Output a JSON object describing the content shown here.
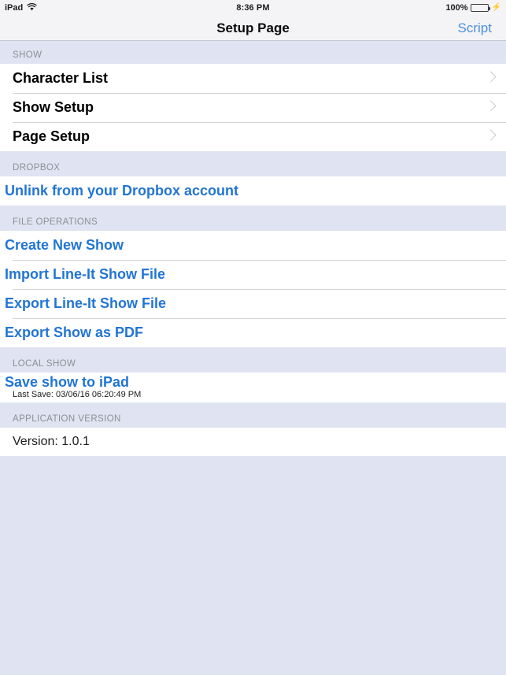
{
  "status_bar": {
    "device": "iPad",
    "wifi_icon": "wifi-icon",
    "time": "8:36 PM",
    "battery_percent": "100%",
    "battery_icon": "battery-full-icon",
    "charging_icon": "lightning-bolt-icon"
  },
  "nav": {
    "title": "Setup Page",
    "right_button": "Script"
  },
  "sections": [
    {
      "header": "SHOW",
      "rows": [
        {
          "label": "Character List",
          "style": "dark",
          "accessory": "chevron-right-icon"
        },
        {
          "label": "Show Setup",
          "style": "dark",
          "accessory": "chevron-right-icon"
        },
        {
          "label": "Page Setup",
          "style": "dark",
          "accessory": "chevron-right-icon"
        }
      ]
    },
    {
      "header": "DROPBOX",
      "rows": [
        {
          "label": "Unlink from your Dropbox account",
          "style": "link"
        }
      ]
    },
    {
      "header": "FILE OPERATIONS",
      "rows": [
        {
          "label": "Create New Show",
          "style": "link"
        },
        {
          "label": "Import Line-It Show File",
          "style": "link"
        },
        {
          "label": "Export Line-It Show File",
          "style": "link"
        },
        {
          "label": "Export Show as PDF",
          "style": "link"
        }
      ]
    },
    {
      "header": "LOCAL SHOW",
      "rows": [
        {
          "label": "Save show to iPad",
          "style": "save",
          "subtitle": "Last Save: 03/06/16 06:20:49 PM"
        }
      ]
    },
    {
      "header": "APPLICATION VERSION",
      "rows": [
        {
          "label": "Version: 1.0.1",
          "style": "plain"
        }
      ]
    }
  ],
  "colors": {
    "link_blue": "#2275d4",
    "nav_blue": "#4a90d9",
    "section_bg": "#dfe3f2",
    "nav_bg": "#f4f4f7",
    "row_bg": "#ffffff",
    "header_text": "#8e8e93",
    "battery_green": "#4cd264"
  }
}
